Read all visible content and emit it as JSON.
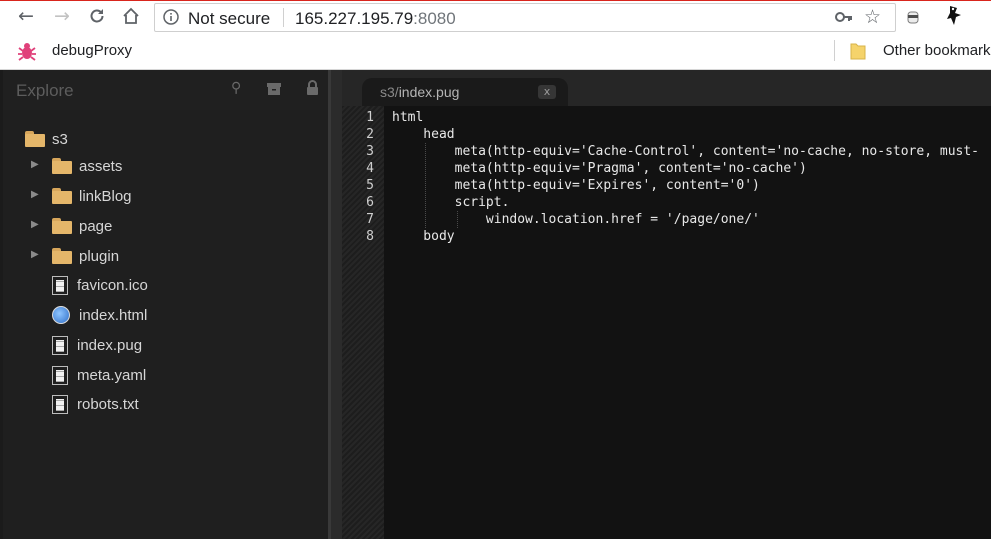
{
  "browser": {
    "security_label": "Not secure",
    "url_host": "165.227.195.79",
    "url_port": ":8080",
    "nav_icons": {
      "back": "back-arrow-icon",
      "forward": "forward-arrow-icon",
      "reload": "reload-icon",
      "home": "home-icon"
    },
    "bookmarks": [
      {
        "label": "debugProxy",
        "icon": "bug-icon"
      },
      {
        "label": "Other bookmarks",
        "icon": "folder-icon"
      }
    ]
  },
  "sidebar": {
    "title": "Explore",
    "tree": [
      {
        "label": "s3",
        "type": "folder",
        "level": 0
      },
      {
        "label": "assets",
        "type": "folder",
        "level": 1,
        "collapsed": true
      },
      {
        "label": "linkBlog",
        "type": "folder",
        "level": 1,
        "collapsed": true
      },
      {
        "label": "page",
        "type": "folder",
        "level": 1,
        "collapsed": true
      },
      {
        "label": "plugin",
        "type": "folder",
        "level": 1,
        "collapsed": true
      },
      {
        "label": "favicon.ico",
        "type": "file",
        "level": 1
      },
      {
        "label": "index.html",
        "type": "html",
        "level": 1
      },
      {
        "label": "index.pug",
        "type": "file",
        "level": 1
      },
      {
        "label": "meta.yaml",
        "type": "file",
        "level": 1
      },
      {
        "label": "robots.txt",
        "type": "file",
        "level": 1
      }
    ]
  },
  "editor": {
    "tab": {
      "path_prefix": "s3/",
      "filename": "index.pug",
      "close_label": "x"
    },
    "lines": [
      {
        "no": "1",
        "text": "html"
      },
      {
        "no": "2",
        "text": "    head"
      },
      {
        "no": "3",
        "text": "        meta(http-equiv='Cache-Control', content='no-cache, no-store, must-"
      },
      {
        "no": "4",
        "text": "        meta(http-equiv='Pragma', content='no-cache')"
      },
      {
        "no": "5",
        "text": "        meta(http-equiv='Expires', content='0')"
      },
      {
        "no": "6",
        "text": "        script."
      },
      {
        "no": "7",
        "text": "            window.location.href = '/page/one/'"
      },
      {
        "no": "8",
        "text": "    body"
      }
    ]
  }
}
